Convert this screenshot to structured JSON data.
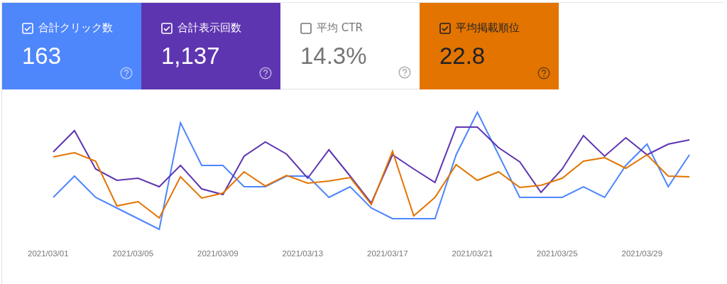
{
  "metrics": [
    {
      "label": "合計クリック数",
      "value": "163",
      "checked": true,
      "color": "#4e86fc"
    },
    {
      "label": "合計表示回数",
      "value": "1,137",
      "checked": true,
      "color": "#5e35b1"
    },
    {
      "label": "平均 CTR",
      "value": "14.3%",
      "checked": false
    },
    {
      "label": "平均掲載順位",
      "value": "22.8",
      "checked": true,
      "color": "#e37400"
    }
  ],
  "chart": {
    "x_labels": [
      "2021/03/01",
      "2021/03/05",
      "2021/03/09",
      "2021/03/13",
      "2021/03/17",
      "2021/03/21",
      "2021/03/25",
      "2021/03/29"
    ]
  }
}
